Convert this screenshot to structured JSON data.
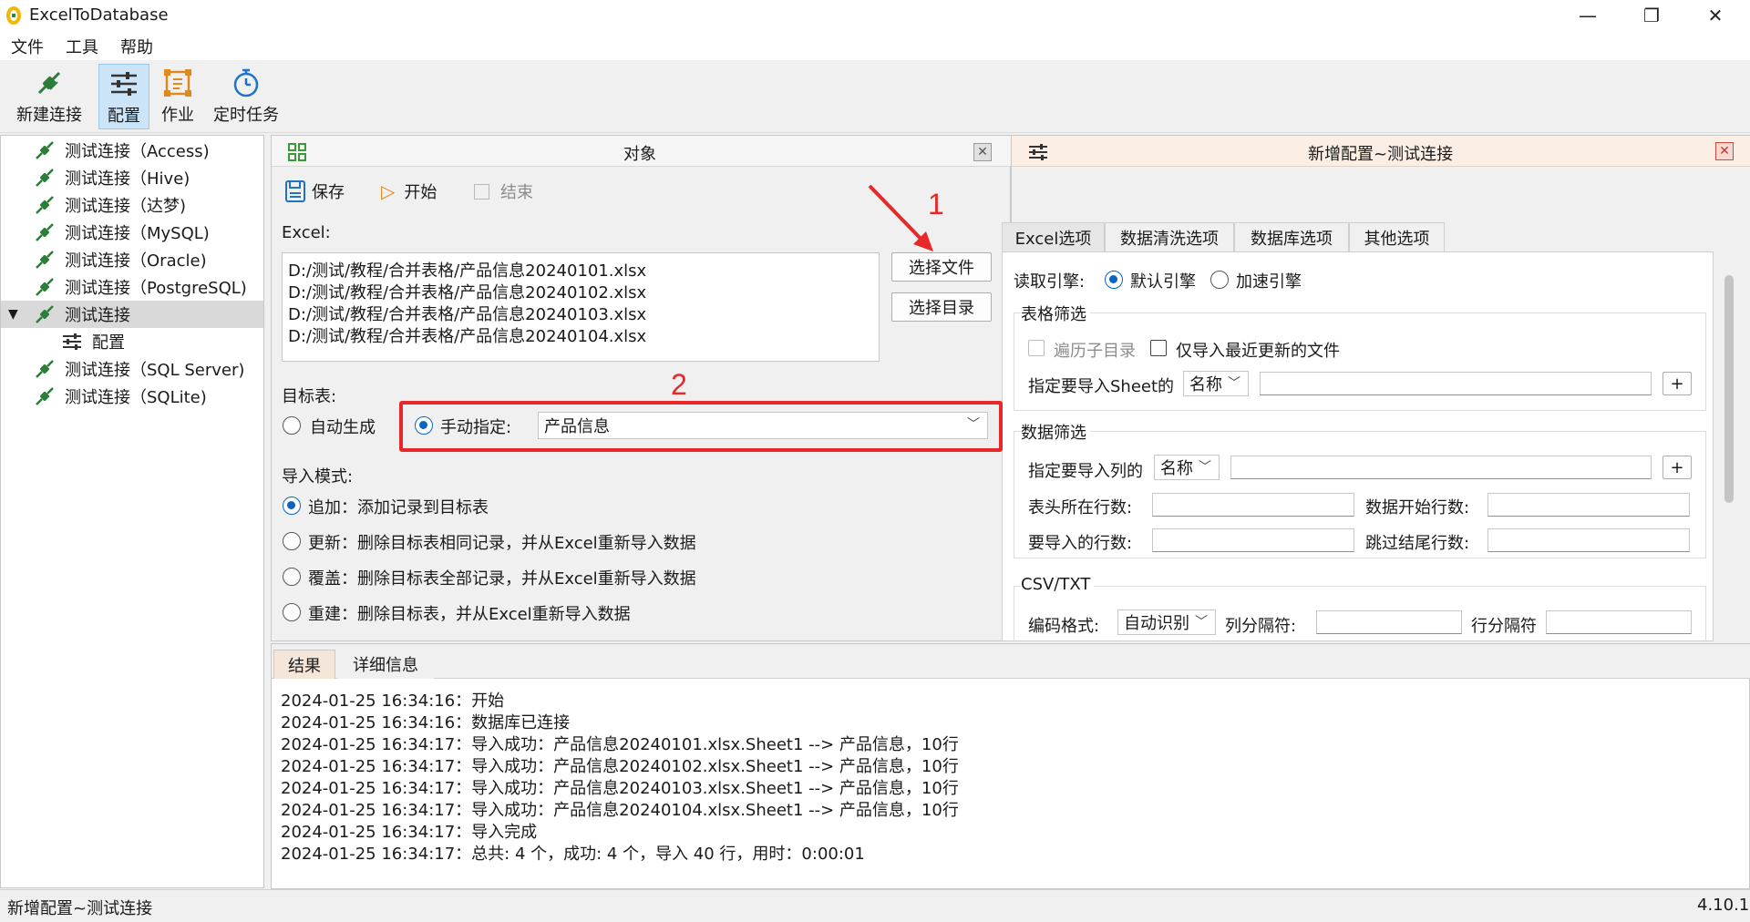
{
  "window": {
    "title": "ExcelToDatabase",
    "controls": {
      "minimize": "—",
      "maximize": "❐",
      "close": "✕"
    }
  },
  "menu": {
    "items": [
      "文件",
      "工具",
      "帮助"
    ]
  },
  "toolbar": {
    "new_connection": "新建连接",
    "config": "配置",
    "job": "作业",
    "scheduled": "定时任务"
  },
  "tree": {
    "items": [
      {
        "label": "测试连接（Access)"
      },
      {
        "label": "测试连接（Hive)"
      },
      {
        "label": "测试连接（达梦)"
      },
      {
        "label": "测试连接（MySQL)"
      },
      {
        "label": "测试连接（Oracle)"
      },
      {
        "label": "测试连接（PostgreSQL)"
      },
      {
        "label": "测试连接"
      },
      {
        "label": "配置"
      },
      {
        "label": "测试连接（SQL Server)"
      },
      {
        "label": "测试连接（SQLite)"
      }
    ]
  },
  "object_panel": {
    "title": "对象",
    "save": "保存",
    "start": "开始",
    "end": "结束",
    "excel_label": "Excel:",
    "files": [
      "D:/测试/教程/合并表格/产品信息20240101.xlsx",
      "D:/测试/教程/合并表格/产品信息20240102.xlsx",
      "D:/测试/教程/合并表格/产品信息20240103.xlsx",
      "D:/测试/教程/合并表格/产品信息20240104.xlsx"
    ],
    "select_file": "选择文件",
    "select_dir": "选择目录",
    "target_label": "目标表:",
    "auto_generate": "自动生成",
    "manual": "手动指定:",
    "manual_value": "产品信息",
    "mode_label": "导入模式:",
    "modes": [
      "追加：添加记录到目标表",
      "更新：删除目标表相同记录，并从Excel重新导入数据",
      "覆盖：删除目标表全部记录，并从Excel重新导入数据",
      "重建：删除目标表，并从Excel重新导入数据"
    ]
  },
  "config_panel": {
    "title": "新增配置~测试连接",
    "tabs": [
      "Excel选项",
      "数据清洗选项",
      "数据库选项",
      "其他选项"
    ],
    "engine_label": "读取引擎:",
    "engine_default": "默认引擎",
    "engine_fast": "加速引擎",
    "table_filter": "表格筛选",
    "traverse_sub": "遍历子目录",
    "recent_only": "仅导入最近更新的文件",
    "sheet_label": "指定要导入Sheet的",
    "sheet_select": "名称",
    "data_filter": "数据筛选",
    "column_label": "指定要导入列的",
    "column_select": "名称",
    "header_row": "表头所在行数:",
    "data_start": "数据开始行数:",
    "rows_to_import": "要导入的行数:",
    "skip_tail": "跳过结尾行数:",
    "csv_group": "CSV/TXT",
    "encoding_label": "编码格式:",
    "encoding_value": "自动识别",
    "col_sep": "列分隔符:",
    "row_sep": "行分隔符",
    "plus": "+"
  },
  "results": {
    "tabs": [
      "结果",
      "详细信息"
    ],
    "lines": [
      "2024-01-25 16:34:16：开始",
      "2024-01-25 16:34:16：数据库已连接",
      "2024-01-25 16:34:17：导入成功：产品信息20240101.xlsx.Sheet1 --> 产品信息，10行",
      "2024-01-25 16:34:17：导入成功：产品信息20240102.xlsx.Sheet1 --> 产品信息，10行",
      "2024-01-25 16:34:17：导入成功：产品信息20240103.xlsx.Sheet1 --> 产品信息，10行",
      "2024-01-25 16:34:17：导入成功：产品信息20240104.xlsx.Sheet1 --> 产品信息，10行",
      "2024-01-25 16:34:17：导入完成",
      "2024-01-25 16:34:17：总共: 4 个，成功: 4 个，导入 40 行，用时：0:00:01"
    ]
  },
  "status": {
    "left": "新增配置~测试连接",
    "version": "4.10.1"
  },
  "annotations": {
    "one": "1",
    "two": "2"
  },
  "colors": {
    "accent": "#0b64c0",
    "annotation": "#e82828",
    "config_header": "#fbeee4"
  }
}
